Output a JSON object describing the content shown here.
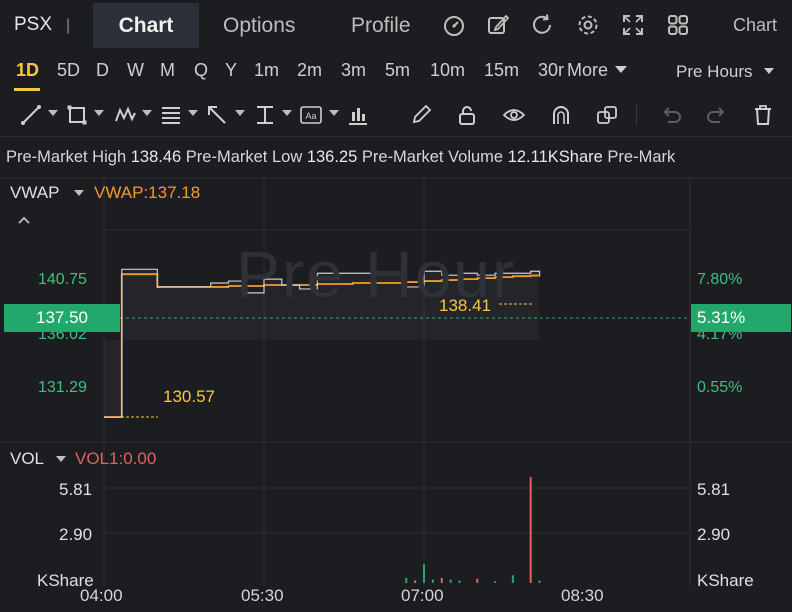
{
  "header": {
    "ticker": "PSX",
    "separator": "|",
    "tabs": [
      "Chart",
      "Options",
      "Profile"
    ],
    "active_tab": "Chart",
    "right_label": "Chart",
    "icons": [
      "gauge-icon",
      "edit-icon",
      "refresh-icon",
      "gear-icon",
      "expand-icon",
      "grid-icon"
    ]
  },
  "timeframes": {
    "items": [
      "1D",
      "5D",
      "D",
      "W",
      "M",
      "Q",
      "Y",
      "1m",
      "2m",
      "3m",
      "5m",
      "10m",
      "15m",
      "30r",
      "More"
    ],
    "active": "1D",
    "session": "Pre Hours"
  },
  "premarket": {
    "high_label": "Pre-Market High",
    "high": "138.46",
    "low_label": "Pre-Market Low",
    "low": "136.25",
    "volume_label": "Pre-Market Volume",
    "volume": "12.11KShare",
    "tail": "Pre-Mark"
  },
  "main_panel": {
    "indicator": "VWAP",
    "indicator_value": "VWAP:137.18",
    "watermark": "Pre Hour",
    "left_axis": [
      "140.75",
      "136.02",
      "131.29"
    ],
    "right_axis": [
      "7.80%",
      "4.17%",
      "0.55%"
    ],
    "current_price": "137.50",
    "current_change": "5.31%",
    "high_annotation": "138.41",
    "low_annotation": "130.57"
  },
  "volume_panel": {
    "indicator": "VOL",
    "indicator_value": "VOL1:0.00",
    "axis": [
      "5.81",
      "2.90",
      "KShare"
    ]
  },
  "x_axis": [
    "04:00",
    "05:30",
    "07:00",
    "08:30"
  ],
  "colors": {
    "background": "#1c1d21",
    "up": "#21a86a",
    "vwap": "#f29a2e",
    "annotation": "#f5c842",
    "down": "#e0635a"
  },
  "chart_data": {
    "type": "line",
    "xlabel": "",
    "ylabel": "",
    "ylim": [
      129.4,
      142.6
    ],
    "x": [
      "04:00",
      "04:10",
      "04:20",
      "04:30",
      "04:40",
      "04:50",
      "05:00",
      "05:10",
      "05:20",
      "05:30",
      "05:40",
      "05:50",
      "06:00",
      "06:10",
      "06:20",
      "06:30",
      "06:40",
      "06:50",
      "07:00",
      "07:10",
      "07:20",
      "07:30",
      "07:40",
      "07:50",
      "08:00",
      "08:05"
    ],
    "series": [
      {
        "name": "Price",
        "values": [
          130.57,
          138.1,
          138.1,
          137.2,
          137.2,
          137.2,
          137.4,
          137.5,
          136.9,
          137.6,
          137.3,
          137.1,
          137.9,
          137.9,
          137.9,
          137.9,
          137.9,
          137.2,
          138.0,
          137.8,
          137.9,
          137.8,
          137.9,
          137.9,
          138.0,
          137.8
        ]
      },
      {
        "name": "VWAP",
        "values": [
          130.57,
          137.85,
          137.85,
          137.2,
          137.2,
          137.2,
          137.2,
          137.25,
          137.25,
          137.3,
          137.3,
          137.3,
          137.35,
          137.35,
          137.4,
          137.4,
          137.4,
          137.45,
          137.5,
          137.55,
          137.6,
          137.65,
          137.7,
          137.75,
          137.78,
          137.8
        ]
      }
    ],
    "volume": {
      "x": [
        "06:50",
        "06:55",
        "07:00",
        "07:05",
        "07:10",
        "07:15",
        "07:20",
        "07:30",
        "07:40",
        "07:50",
        "08:00",
        "08:05"
      ],
      "values": [
        0.3,
        0.15,
        1.1,
        0.2,
        0.3,
        0.2,
        0.15,
        0.25,
        0.1,
        0.45,
        6.2,
        0.15
      ],
      "ylim": [
        0,
        6.6
      ]
    }
  }
}
